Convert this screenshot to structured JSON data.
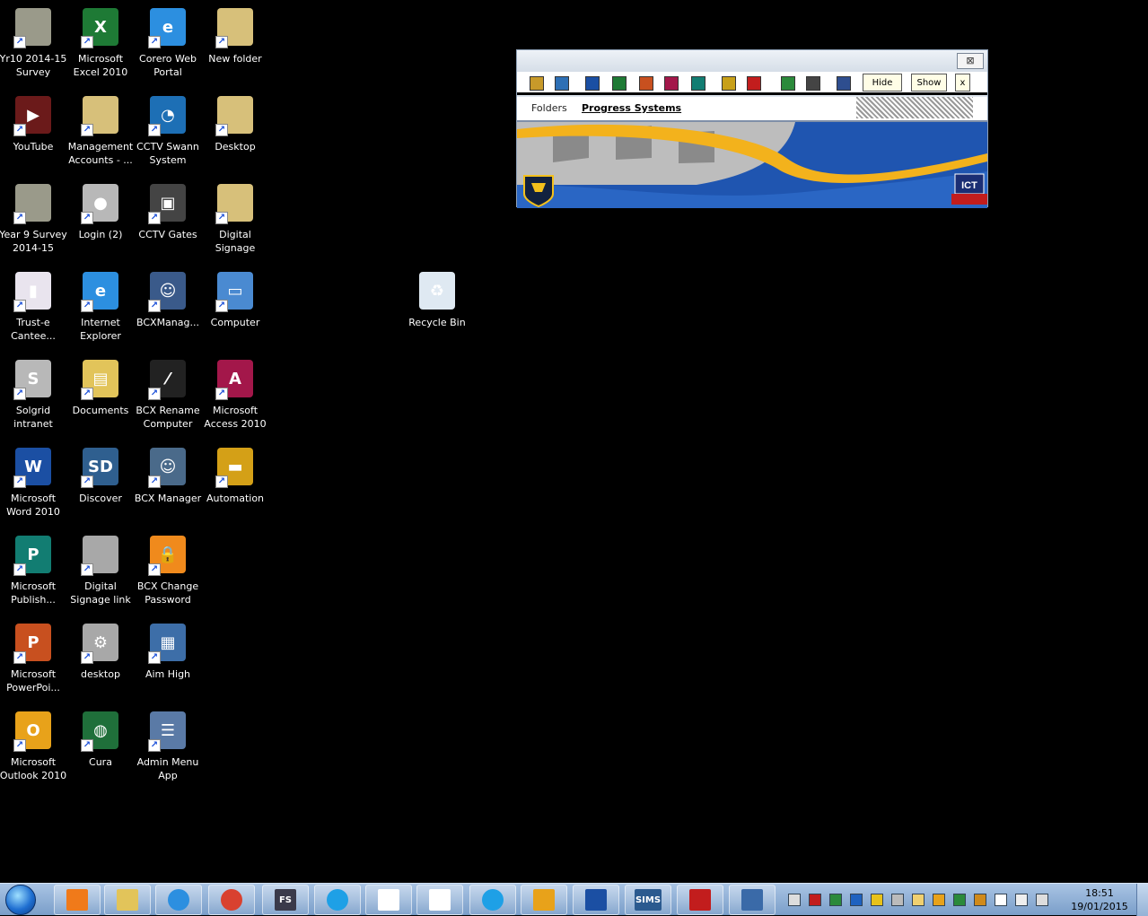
{
  "desktop": {
    "icons": [
      {
        "label": "Yr10 2014-15 Survey",
        "icon": "survey-shortcut-icon"
      },
      {
        "label": "Microsoft Excel 2010",
        "icon": "excel-icon"
      },
      {
        "label": "Corero Web Portal",
        "icon": "internet-explorer-icon"
      },
      {
        "label": "New folder",
        "icon": "folder-icon"
      },
      {
        "label": "YouTube",
        "icon": "youtube-icon"
      },
      {
        "label": "Management Accounts - ...",
        "icon": "folder-icon"
      },
      {
        "label": "CCTV Swann System",
        "icon": "cctv-swann-icon"
      },
      {
        "label": "Desktop",
        "icon": "folder-icon"
      },
      {
        "label": "Year 9 Survey 2014-15",
        "icon": "survey-shortcut-icon"
      },
      {
        "label": "Login (2)",
        "icon": "login-icon"
      },
      {
        "label": "CCTV Gates",
        "icon": "camcorder-icon"
      },
      {
        "label": "Digital Signage",
        "icon": "folder-icon"
      },
      {
        "label": "Trust-e Cantee...",
        "icon": "bar-chart-icon"
      },
      {
        "label": "Internet Explorer",
        "icon": "internet-explorer-icon"
      },
      {
        "label": "BCXManag...",
        "icon": "user-gear-icon"
      },
      {
        "label": "Computer",
        "icon": "computer-icon"
      },
      {
        "label": "Solgrid intranet",
        "icon": "solgrid-icon"
      },
      {
        "label": "Documents",
        "icon": "documents-folder-icon"
      },
      {
        "label": "BCX Rename Computer",
        "icon": "rename-icon"
      },
      {
        "label": "Microsoft Access 2010",
        "icon": "access-icon"
      },
      {
        "label": "Microsoft Word 2010",
        "icon": "word-icon"
      },
      {
        "label": "Discover",
        "icon": "sd-discover-icon"
      },
      {
        "label": "BCX Manager",
        "icon": "users-icon"
      },
      {
        "label": "Automation",
        "icon": "briefcase-folder-icon"
      },
      {
        "label": "Microsoft Publish...",
        "icon": "publisher-icon"
      },
      {
        "label": "Digital Signage link",
        "icon": "file-icon"
      },
      {
        "label": "BCX Change Password",
        "icon": "lock-icon"
      },
      {
        "label": "Microsoft PowerPoi...",
        "icon": "powerpoint-icon"
      },
      {
        "label": "desktop",
        "icon": "settings-file-icon"
      },
      {
        "label": "Aim High",
        "icon": "network-computers-icon"
      },
      {
        "label": "Microsoft Outlook 2010",
        "icon": "outlook-icon"
      },
      {
        "label": "Cura",
        "icon": "globe-icon"
      },
      {
        "label": "Admin Menu App",
        "icon": "admin-menu-icon"
      }
    ],
    "recycle_bin": {
      "label": "Recycle Bin",
      "icon": "recycle-bin-icon"
    }
  },
  "toolbar_window": {
    "close_label": "⊠",
    "hide_label": "Hide",
    "show_label": "Show",
    "small_close_label": "x",
    "tabs": [
      "Folders",
      "Progress Systems"
    ],
    "banner_badge": "ICT",
    "app_buttons": [
      {
        "icon": "folder-app-icon",
        "color": "#c89a2a"
      },
      {
        "icon": "sims-app-icon",
        "color": "#2d6fb5"
      },
      {
        "icon": "word-app-icon",
        "color": "#1b4fa3"
      },
      {
        "icon": "excel-app-icon",
        "color": "#1e7a35"
      },
      {
        "icon": "powerpoint-app-icon",
        "color": "#c8501f"
      },
      {
        "icon": "access-app-icon",
        "color": "#a3174a"
      },
      {
        "icon": "publisher-app-icon",
        "color": "#127d72"
      },
      {
        "icon": "app-u-icon",
        "color": "#c8a019"
      },
      {
        "icon": "app-fb-icon",
        "color": "#c21d1d"
      },
      {
        "icon": "app-triangle-icon",
        "color": "#2b8a3b"
      },
      {
        "icon": "traffic-light-icon",
        "color": "#444444"
      },
      {
        "icon": "help-app-icon",
        "color": "#2e4e8f"
      }
    ]
  },
  "taskbar": {
    "buttons": [
      {
        "icon": "media-player-icon"
      },
      {
        "icon": "explorer-icon"
      },
      {
        "icon": "internet-explorer-icon"
      },
      {
        "icon": "chrome-icon"
      },
      {
        "icon": "fs-icon",
        "text": "FS"
      },
      {
        "icon": "skype-icon"
      },
      {
        "icon": "blank-document-icon"
      },
      {
        "icon": "blank-document-icon"
      },
      {
        "icon": "skype-icon"
      },
      {
        "icon": "outlook-icon"
      },
      {
        "icon": "word-icon"
      },
      {
        "icon": "sims-icon",
        "text": "SIMS"
      },
      {
        "icon": "pdf-icon"
      },
      {
        "icon": "admin-user-icon"
      }
    ],
    "clock_time": "18:51",
    "clock_date": "19/01/2015"
  }
}
